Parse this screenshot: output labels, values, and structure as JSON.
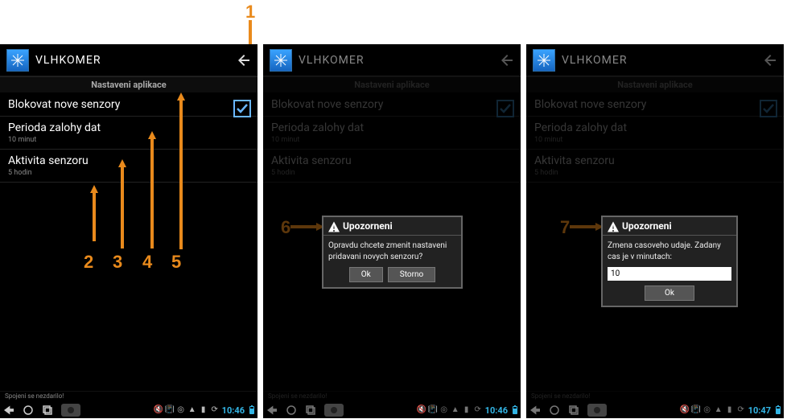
{
  "app": {
    "title": "VLHKOMER"
  },
  "header": {
    "settings": "Nastaveni aplikace"
  },
  "settings": {
    "block_new": {
      "title": "Blokovat nove senzory"
    },
    "backup_period": {
      "title": "Perioda zalohy dat",
      "sub": "10 minut"
    },
    "sensor_activity": {
      "title": "Aktivita senzoru",
      "sub": "5 hodin"
    }
  },
  "footer": {
    "status": "Spojeni se nezdarilo!"
  },
  "status": {
    "time_a": "10:46",
    "time_b": "10:46",
    "time_c": "10:47"
  },
  "dialog_confirm": {
    "title": "Upozorneni",
    "text": "Opravdu chcete zmenit nastaveni pridavani novych senzoru?",
    "ok": "Ok",
    "cancel": "Storno"
  },
  "dialog_time": {
    "title": "Upozorneni",
    "text": "Zmena casoveho udaje. Zadany cas je v minutach:",
    "value": "10",
    "ok": "Ok"
  },
  "callouts": {
    "c1": "1",
    "c2": "2",
    "c3": "3",
    "c4": "4",
    "c5": "5",
    "c6": "6",
    "c7": "7"
  }
}
